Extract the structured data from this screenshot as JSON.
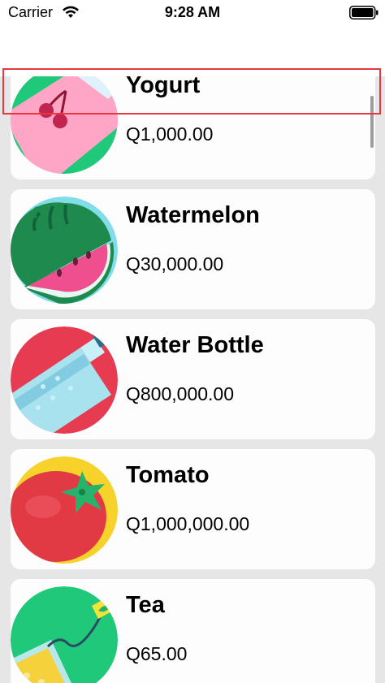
{
  "status_bar": {
    "carrier": "Carrier",
    "time": "9:28 AM"
  },
  "products": [
    {
      "name": "Yogurt",
      "price": "Q1,000.00",
      "icon": "yogurt-icon"
    },
    {
      "name": "Watermelon",
      "price": "Q30,000.00",
      "icon": "watermelon-icon"
    },
    {
      "name": "Water Bottle",
      "price": "Q800,000.00",
      "icon": "water-bottle-icon"
    },
    {
      "name": "Tomato",
      "price": "Q1,000,000.00",
      "icon": "tomato-icon"
    },
    {
      "name": "Tea",
      "price": "Q65.00",
      "icon": "tea-icon"
    }
  ],
  "colors": {
    "list_background": "#e6e6e6",
    "card_background": "#fdfdfd",
    "highlight": "#e8383d"
  }
}
